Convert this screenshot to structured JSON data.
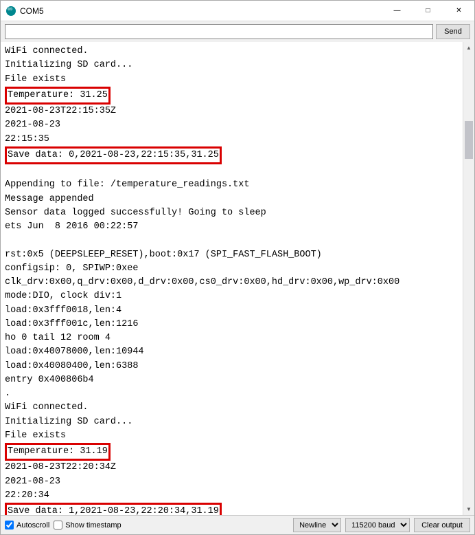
{
  "window": {
    "title": "COM5"
  },
  "toolbar": {
    "send_label": "Send",
    "input_value": ""
  },
  "console": {
    "lines": [
      {
        "text": "WiFi connected."
      },
      {
        "text": "Initializing SD card..."
      },
      {
        "text": "File exists"
      },
      {
        "text": "Temperature: 31.25",
        "highlight": true
      },
      {
        "text": "2021-08-23T22:15:35Z"
      },
      {
        "text": "2021-08-23"
      },
      {
        "text": "22:15:35"
      },
      {
        "text": "Save data: 0,2021-08-23,22:15:35,31.25",
        "highlight": true
      },
      {
        "text": ""
      },
      {
        "text": "Appending to file: /temperature_readings.txt"
      },
      {
        "text": "Message appended"
      },
      {
        "text": "Sensor data logged successfully! Going to sleep"
      },
      {
        "text": "ets Jun  8 2016 00:22:57"
      },
      {
        "text": ""
      },
      {
        "text": "rst:0x5 (DEEPSLEEP_RESET),boot:0x17 (SPI_FAST_FLASH_BOOT)"
      },
      {
        "text": "configsip: 0, SPIWP:0xee"
      },
      {
        "text": "clk_drv:0x00,q_drv:0x00,d_drv:0x00,cs0_drv:0x00,hd_drv:0x00,wp_drv:0x00"
      },
      {
        "text": "mode:DIO, clock div:1"
      },
      {
        "text": "load:0x3fff0018,len:4"
      },
      {
        "text": "load:0x3fff001c,len:1216"
      },
      {
        "text": "ho 0 tail 12 room 4"
      },
      {
        "text": "load:0x40078000,len:10944"
      },
      {
        "text": "load:0x40080400,len:6388"
      },
      {
        "text": "entry 0x400806b4"
      },
      {
        "text": "."
      },
      {
        "text": "WiFi connected."
      },
      {
        "text": "Initializing SD card..."
      },
      {
        "text": "File exists"
      },
      {
        "text": "Temperature: 31.19",
        "highlight": true
      },
      {
        "text": "2021-08-23T22:20:34Z"
      },
      {
        "text": "2021-08-23"
      },
      {
        "text": "22:20:34"
      },
      {
        "text": "Save data: 1,2021-08-23,22:20:34,31.19",
        "highlight": true
      }
    ]
  },
  "footer": {
    "autoscroll_label": "Autoscroll",
    "autoscroll_checked": true,
    "timestamp_label": "Show timestamp",
    "timestamp_checked": false,
    "line_ending": "Newline",
    "baud": "115200 baud",
    "clear_label": "Clear output"
  }
}
